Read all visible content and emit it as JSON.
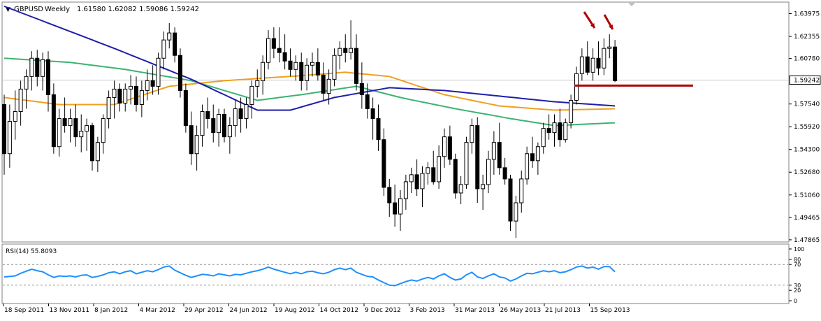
{
  "header": {
    "menu_arrow": "▼",
    "symbol": "GBPUSD",
    "timeframe": "Weekly",
    "quote": "1.61580 1.62082 1.59086 1.59242"
  },
  "colors": {
    "background": "#ffffff",
    "grid": "#c8c8c8",
    "candle_up": "#ffffff",
    "candle_down": "#000000",
    "ma_blue": "#1e1eaa",
    "ma_orange": "#f0a020",
    "ma_green": "#3cb371",
    "rsi_line": "#1e90ff",
    "annotation_red": "#b00000",
    "current_price_box": "#ffffff"
  },
  "chart_data": [
    {
      "type": "candlestick",
      "symbol": "GBPUSD",
      "timeframe": "Weekly",
      "ylim": [
        1.4786,
        1.6405
      ],
      "y_ticks": [
        "1.63975",
        "1.62355",
        "1.60780",
        "1.59242",
        "1.57540",
        "1.55920",
        "1.54300",
        "1.52680",
        "1.51060",
        "1.49465",
        "1.47865"
      ],
      "current_price": "1.59242",
      "x_labels": [
        "18 Sep 2011",
        "13 Nov 2011",
        "8 Jan 2012",
        "4 Mar 2012",
        "29 Apr 2012",
        "24 Jun 2012",
        "19 Aug 2012",
        "14 Oct 2012",
        "9 Dec 2012",
        "3 Feb 2013",
        "31 Mar 2013",
        "26 May 2013",
        "21 Jul 2013",
        "15 Sep 2013"
      ],
      "candles_ohlc": [
        [
          1.575,
          1.582,
          1.525,
          1.54
        ],
        [
          1.54,
          1.575,
          1.53,
          1.563
        ],
        [
          1.563,
          1.585,
          1.55,
          1.57
        ],
        [
          1.57,
          1.592,
          1.56,
          1.586
        ],
        [
          1.586,
          1.6,
          1.572,
          1.595
        ],
        [
          1.595,
          1.613,
          1.585,
          1.608
        ],
        [
          1.608,
          1.614,
          1.588,
          1.595
        ],
        [
          1.595,
          1.612,
          1.585,
          1.607
        ],
        [
          1.607,
          1.613,
          1.57,
          1.582
        ],
        [
          1.582,
          1.59,
          1.54,
          1.545
        ],
        [
          1.545,
          1.572,
          1.538,
          1.565
        ],
        [
          1.565,
          1.58,
          1.555,
          1.56
        ],
        [
          1.56,
          1.572,
          1.548,
          1.565
        ],
        [
          1.565,
          1.575,
          1.545,
          1.552
        ],
        [
          1.552,
          1.568,
          1.541,
          1.556
        ],
        [
          1.556,
          1.565,
          1.542,
          1.56
        ],
        [
          1.56,
          1.562,
          1.528,
          1.535
        ],
        [
          1.535,
          1.552,
          1.527,
          1.548
        ],
        [
          1.548,
          1.568,
          1.54,
          1.565
        ],
        [
          1.565,
          1.585,
          1.558,
          1.58
        ],
        [
          1.58,
          1.592,
          1.565,
          1.586
        ],
        [
          1.586,
          1.59,
          1.57,
          1.576
        ],
        [
          1.576,
          1.59,
          1.57,
          1.586
        ],
        [
          1.586,
          1.596,
          1.575,
          1.588
        ],
        [
          1.588,
          1.595,
          1.57,
          1.575
        ],
        [
          1.575,
          1.592,
          1.566,
          1.585
        ],
        [
          1.585,
          1.6,
          1.578,
          1.592
        ],
        [
          1.592,
          1.603,
          1.582,
          1.588
        ],
        [
          1.588,
          1.612,
          1.582,
          1.608
        ],
        [
          1.608,
          1.627,
          1.6,
          1.621
        ],
        [
          1.621,
          1.633,
          1.615,
          1.626
        ],
        [
          1.626,
          1.63,
          1.605,
          1.61
        ],
        [
          1.61,
          1.615,
          1.58,
          1.585
        ],
        [
          1.585,
          1.59,
          1.555,
          1.56
        ],
        [
          1.56,
          1.57,
          1.532,
          1.54
        ],
        [
          1.54,
          1.56,
          1.528,
          1.553
        ],
        [
          1.553,
          1.575,
          1.545,
          1.57
        ],
        [
          1.57,
          1.58,
          1.558,
          1.565
        ],
        [
          1.565,
          1.575,
          1.548,
          1.555
        ],
        [
          1.555,
          1.572,
          1.545,
          1.568
        ],
        [
          1.568,
          1.572,
          1.548,
          1.552
        ],
        [
          1.552,
          1.566,
          1.54,
          1.56
        ],
        [
          1.56,
          1.578,
          1.552,
          1.572
        ],
        [
          1.572,
          1.58,
          1.555,
          1.565
        ],
        [
          1.565,
          1.58,
          1.558,
          1.575
        ],
        [
          1.575,
          1.592,
          1.565,
          1.588
        ],
        [
          1.588,
          1.6,
          1.58,
          1.592
        ],
        [
          1.592,
          1.61,
          1.582,
          1.605
        ],
        [
          1.605,
          1.628,
          1.6,
          1.622
        ],
        [
          1.622,
          1.63,
          1.608,
          1.615
        ],
        [
          1.615,
          1.63,
          1.605,
          1.612
        ],
        [
          1.612,
          1.625,
          1.6,
          1.606
        ],
        [
          1.606,
          1.615,
          1.595,
          1.6
        ],
        [
          1.6,
          1.61,
          1.592,
          1.605
        ],
        [
          1.605,
          1.612,
          1.585,
          1.592
        ],
        [
          1.592,
          1.608,
          1.585,
          1.603
        ],
        [
          1.603,
          1.612,
          1.595,
          1.605
        ],
        [
          1.605,
          1.615,
          1.592,
          1.596
        ],
        [
          1.596,
          1.605,
          1.578,
          1.583
        ],
        [
          1.583,
          1.6,
          1.575,
          1.593
        ],
        [
          1.593,
          1.615,
          1.588,
          1.61
        ],
        [
          1.61,
          1.62,
          1.6,
          1.615
        ],
        [
          1.615,
          1.625,
          1.605,
          1.612
        ],
        [
          1.612,
          1.635,
          1.607,
          1.615
        ],
        [
          1.615,
          1.625,
          1.585,
          1.59
        ],
        [
          1.59,
          1.605,
          1.572,
          1.582
        ],
        [
          1.582,
          1.59,
          1.565,
          1.572
        ],
        [
          1.572,
          1.58,
          1.55,
          1.565
        ],
        [
          1.565,
          1.575,
          1.542,
          1.55
        ],
        [
          1.55,
          1.558,
          1.51,
          1.516
        ],
        [
          1.516,
          1.522,
          1.495,
          1.505
        ],
        [
          1.505,
          1.518,
          1.488,
          1.497
        ],
        [
          1.497,
          1.514,
          1.485,
          1.508
        ],
        [
          1.508,
          1.525,
          1.5,
          1.52
        ],
        [
          1.52,
          1.53,
          1.512,
          1.525
        ],
        [
          1.525,
          1.536,
          1.51,
          1.515
        ],
        [
          1.515,
          1.531,
          1.502,
          1.526
        ],
        [
          1.526,
          1.534,
          1.518,
          1.53
        ],
        [
          1.53,
          1.542,
          1.518,
          1.52
        ],
        [
          1.52,
          1.546,
          1.515,
          1.538
        ],
        [
          1.538,
          1.558,
          1.53,
          1.552
        ],
        [
          1.552,
          1.56,
          1.532,
          1.536
        ],
        [
          1.536,
          1.54,
          1.508,
          1.512
        ],
        [
          1.512,
          1.524,
          1.504,
          1.518
        ],
        [
          1.518,
          1.552,
          1.515,
          1.548
        ],
        [
          1.548,
          1.565,
          1.54,
          1.56
        ],
        [
          1.56,
          1.566,
          1.505,
          1.515
        ],
        [
          1.515,
          1.525,
          1.5,
          1.518
        ],
        [
          1.518,
          1.542,
          1.512,
          1.536
        ],
        [
          1.536,
          1.556,
          1.525,
          1.548
        ],
        [
          1.548,
          1.562,
          1.525,
          1.53
        ],
        [
          1.53,
          1.537,
          1.518,
          1.522
        ],
        [
          1.522,
          1.525,
          1.485,
          1.492
        ],
        [
          1.492,
          1.51,
          1.48,
          1.505
        ],
        [
          1.505,
          1.528,
          1.498,
          1.522
        ],
        [
          1.522,
          1.545,
          1.518,
          1.54
        ],
        [
          1.54,
          1.552,
          1.53,
          1.535
        ],
        [
          1.535,
          1.548,
          1.525,
          1.545
        ],
        [
          1.545,
          1.562,
          1.54,
          1.558
        ],
        [
          1.558,
          1.568,
          1.55,
          1.555
        ],
        [
          1.555,
          1.568,
          1.545,
          1.562
        ],
        [
          1.562,
          1.572,
          1.545,
          1.55
        ],
        [
          1.55,
          1.565,
          1.548,
          1.562
        ],
        [
          1.562,
          1.582,
          1.558,
          1.578
        ],
        [
          1.578,
          1.602,
          1.575,
          1.597
        ],
        [
          1.597,
          1.615,
          1.592,
          1.609
        ],
        [
          1.609,
          1.62,
          1.596,
          1.598
        ],
        [
          1.598,
          1.615,
          1.592,
          1.608
        ],
        [
          1.608,
          1.62,
          1.596,
          1.601
        ],
        [
          1.601,
          1.622,
          1.596,
          1.615
        ],
        [
          1.615,
          1.625,
          1.608,
          1.616
        ],
        [
          1.616,
          1.621,
          1.591,
          1.592
        ]
      ],
      "ma_blue_anchors": [
        [
          0,
          1.645
        ],
        [
          20,
          1.615
        ],
        [
          34,
          1.593
        ],
        [
          46,
          1.571
        ],
        [
          52,
          1.571
        ],
        [
          60,
          1.58
        ],
        [
          70,
          1.587
        ],
        [
          80,
          1.585
        ],
        [
          90,
          1.581
        ],
        [
          100,
          1.577
        ],
        [
          111,
          1.574
        ]
      ],
      "ma_orange_anchors": [
        [
          0,
          1.58
        ],
        [
          10,
          1.575
        ],
        [
          20,
          1.575
        ],
        [
          30,
          1.588
        ],
        [
          40,
          1.592
        ],
        [
          52,
          1.595
        ],
        [
          62,
          1.598
        ],
        [
          70,
          1.595
        ],
        [
          80,
          1.582
        ],
        [
          90,
          1.574
        ],
        [
          100,
          1.571
        ],
        [
          111,
          1.572
        ]
      ],
      "ma_green_anchors": [
        [
          0,
          1.608
        ],
        [
          12,
          1.605
        ],
        [
          22,
          1.6
        ],
        [
          34,
          1.592
        ],
        [
          46,
          1.578
        ],
        [
          54,
          1.582
        ],
        [
          64,
          1.588
        ],
        [
          72,
          1.58
        ],
        [
          82,
          1.572
        ],
        [
          92,
          1.565
        ],
        [
          100,
          1.56
        ],
        [
          111,
          1.562
        ]
      ],
      "horizontal_level": 1.5885,
      "arrows": [
        "signal arrow 1",
        "signal arrow 2"
      ]
    },
    {
      "type": "line",
      "indicator": "RSI",
      "label": "RSI(14) 55.8093",
      "ylim": [
        0,
        100
      ],
      "y_ticks": [
        "100",
        "80",
        "70",
        "30",
        "20",
        "0"
      ],
      "levels": [
        70,
        30
      ],
      "values": [
        46,
        47,
        48,
        53,
        57,
        61,
        58,
        56,
        50,
        45,
        48,
        47,
        48,
        46,
        49,
        50,
        45,
        47,
        50,
        54,
        56,
        52,
        56,
        58,
        52,
        55,
        58,
        56,
        60,
        65,
        67,
        59,
        54,
        49,
        45,
        48,
        51,
        50,
        48,
        52,
        50,
        48,
        51,
        50,
        53,
        56,
        58,
        61,
        65,
        61,
        58,
        55,
        52,
        55,
        52,
        56,
        57,
        54,
        52,
        55,
        60,
        63,
        60,
        63,
        55,
        51,
        47,
        46,
        40,
        35,
        30,
        29,
        33,
        37,
        40,
        38,
        42,
        45,
        42,
        48,
        52,
        45,
        40,
        42,
        50,
        55,
        46,
        43,
        48,
        52,
        46,
        44,
        38,
        42,
        48,
        53,
        52,
        55,
        58,
        56,
        58,
        54,
        56,
        60,
        65,
        67,
        63,
        65,
        61,
        66,
        66,
        56
      ]
    }
  ]
}
